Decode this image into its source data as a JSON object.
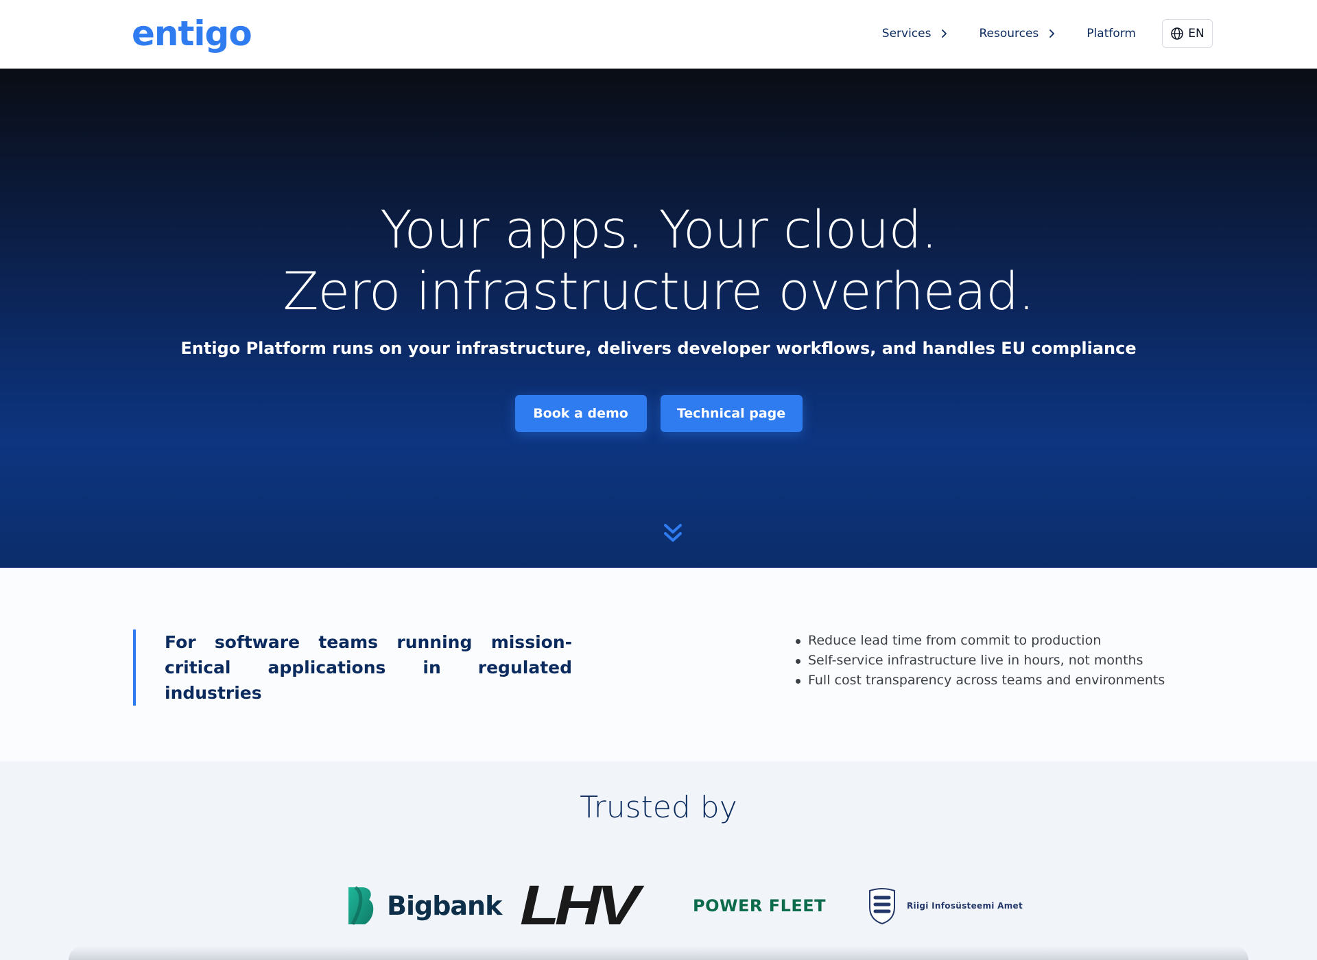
{
  "header": {
    "logo_text": "entigo",
    "nav": [
      {
        "label": "Services",
        "has_chevron": true
      },
      {
        "label": "Resources",
        "has_chevron": true
      },
      {
        "label": "Platform",
        "has_chevron": false
      }
    ],
    "language": "EN",
    "language_icon": "globe-icon"
  },
  "hero": {
    "title_line1": "Your apps. Your cloud.",
    "title_line2": "Zero infrastructure overhead.",
    "subtitle": "Entigo Platform runs on your infrastructure, delivers developer workflows, and handles EU compliance",
    "buttons": {
      "demo": "Book a demo",
      "technical": "Technical page"
    },
    "scroll_icon": "chevron-double-down-icon"
  },
  "intro": {
    "heading": "For software teams running mission-critical applications in regulated industries",
    "bullets": [
      "Reduce lead time from commit to production",
      "Self-service infrastructure live in hours, not months",
      "Full cost transparency across teams and environments"
    ]
  },
  "trusted": {
    "title": "Trusted by",
    "logos": {
      "bigbank": "Bigbank",
      "lhv": "LHV",
      "powerfleet": "POWER FLEET",
      "ria": "Riigi Infosüsteemi Amet"
    }
  },
  "colors": {
    "accent": "#2f7bf0",
    "navy": "#0b2a5e",
    "powerfleet_green": "#0c6b4a"
  }
}
